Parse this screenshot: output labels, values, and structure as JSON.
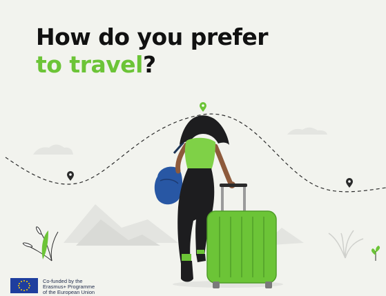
{
  "headline": {
    "line1": "How do you prefer",
    "line2_highlight": "to travel",
    "line2_suffix": "?"
  },
  "footer": {
    "line1": "Co-funded by the",
    "line2": "Erasmus+ Programme",
    "line3": "of the European Union"
  },
  "colors": {
    "accent_green": "#6cc437",
    "background": "#f2f3ee",
    "eu_blue": "#1f3e9e",
    "eu_star": "#ffd200"
  },
  "icons": [
    "map-pin-icon",
    "suitcase-icon",
    "bag-icon",
    "eu-flag-icon"
  ]
}
